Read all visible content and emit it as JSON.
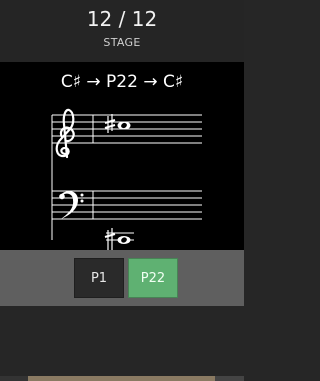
{
  "header": {
    "progress_text": "12 / 12",
    "subtitle": "STAGE"
  },
  "exercise": {
    "prompt": "C♯ → P22 → C♯",
    "clefs": [
      "treble-clef",
      "bass-clef"
    ],
    "accidental": "♯"
  },
  "answers": [
    {
      "label": "P1",
      "state": "default"
    },
    {
      "label": "P22",
      "state": "correct"
    }
  ],
  "progress": {
    "fraction": 0.88
  },
  "colors": {
    "correct": "#5fb172",
    "button_bg": "#2a2a2a",
    "answer_bar": "#5f5f5f",
    "background": "#262626",
    "stage_bg": "#000000"
  }
}
